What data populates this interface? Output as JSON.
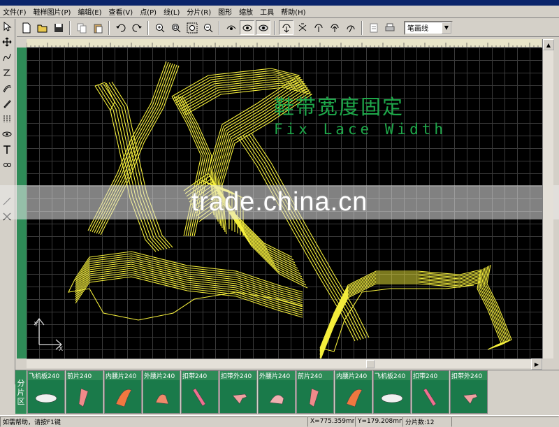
{
  "menu": [
    "文件(F)",
    "鞋样图片(P)",
    "编辑(E)",
    "查看(V)",
    "点(P)",
    "线(L)",
    "分片(R)",
    "图形",
    "缩放",
    "工具",
    "帮助(H)"
  ],
  "toolbar": {
    "icons": [
      "new-file-icon",
      "open-folder-icon",
      "save-icon",
      "copy-icon",
      "paste-icon",
      "undo-icon",
      "redo-icon",
      "zoom-in-icon",
      "zoom-window-icon",
      "zoom-all-icon",
      "zoom-out-icon",
      "view-a-icon",
      "view-b-icon",
      "view-c-icon",
      "rotate-a-icon",
      "rotate-b-icon",
      "rotate-c-icon",
      "rotate-d-icon",
      "rotate-e-icon",
      "export-icon",
      "print-icon"
    ],
    "line_style": "笔画线"
  },
  "canvas": {
    "headline_cn": "鞋带宽度固定",
    "headline_en": "Fix Lace Width",
    "watermark": "trade.china.cn",
    "stroke_color": "#f5ef3c",
    "headline_color": "#1ea84a"
  },
  "pieces": {
    "label": [
      "分",
      "片",
      "区"
    ],
    "items": [
      {
        "label": "飞机板240",
        "color": "#f0f0f0"
      },
      {
        "label": "前片240",
        "color": "#f08a8a"
      },
      {
        "label": "内腰片240",
        "color": "#f07840"
      },
      {
        "label": "外腰片240",
        "color": "#f08a6a"
      },
      {
        "label": "扣带240",
        "color": "#f07090"
      },
      {
        "label": "扣带外240",
        "color": "#f0a0a0"
      },
      {
        "label": "外腰片240",
        "color": "#f0b0b0"
      },
      {
        "label": "前片240",
        "color": "#f08a8a"
      },
      {
        "label": "内腰片240",
        "color": "#f07840"
      },
      {
        "label": "飞机板240",
        "color": "#f0f0f0"
      },
      {
        "label": "扣带240",
        "color": "#f07090"
      },
      {
        "label": "扣带外240",
        "color": "#f0a0a0"
      }
    ]
  },
  "status": {
    "help": "如需帮助，请按F1键",
    "x": "X=775.359mm",
    "y": "Y=179.208mm",
    "count": "分片数:12"
  }
}
